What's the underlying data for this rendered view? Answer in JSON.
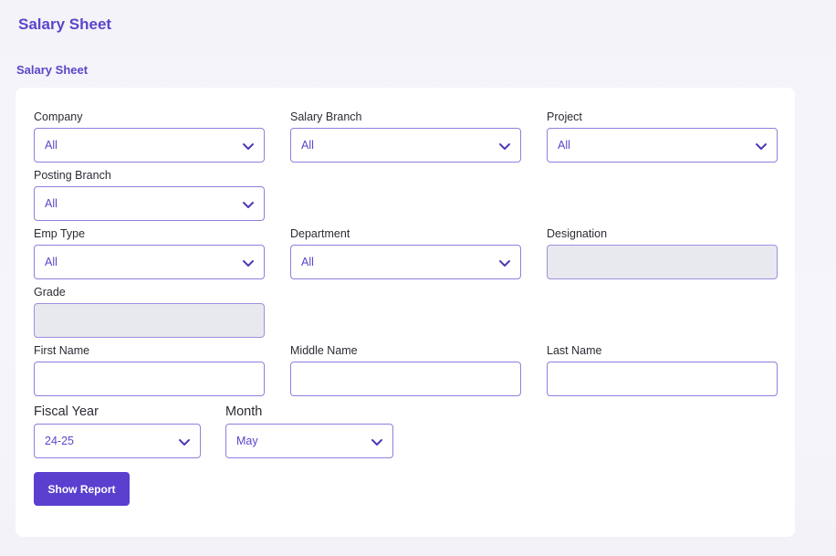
{
  "header": {
    "title": "Salary Sheet"
  },
  "section": {
    "title": "Salary Sheet"
  },
  "form": {
    "company": {
      "label": "Company",
      "value": "All"
    },
    "salary_branch": {
      "label": "Salary Branch",
      "value": "All"
    },
    "project": {
      "label": "Project",
      "value": "All"
    },
    "posting_branch": {
      "label": "Posting Branch",
      "value": "All"
    },
    "emp_type": {
      "label": "Emp Type",
      "value": "All"
    },
    "department": {
      "label": "Department",
      "value": "All"
    },
    "designation": {
      "label": "Designation",
      "value": ""
    },
    "grade": {
      "label": "Grade",
      "value": ""
    },
    "first_name": {
      "label": "First Name",
      "value": ""
    },
    "middle_name": {
      "label": "Middle Name",
      "value": ""
    },
    "last_name": {
      "label": "Last Name",
      "value": ""
    },
    "fiscal_year": {
      "label": "Fiscal Year",
      "value": "24-25"
    },
    "month": {
      "label": "Month",
      "value": "May"
    }
  },
  "actions": {
    "show_report": "Show Report"
  },
  "colors": {
    "accent": "#5b45c9",
    "button": "#5b3fcf",
    "border": "#8f7fe0",
    "disabled_bg": "#e8e9ee"
  },
  "icons": {
    "dropdown": "chevron-down-icon"
  }
}
